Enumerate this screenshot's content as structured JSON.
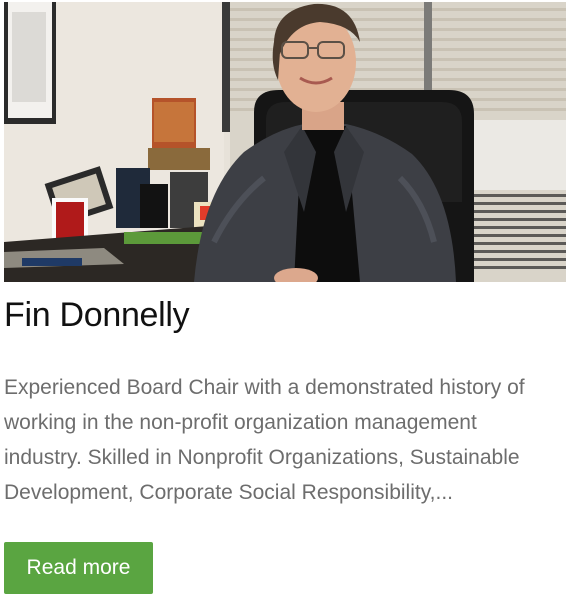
{
  "profile": {
    "name": "Fin Donnelly",
    "description": "Experienced Board Chair with a demonstrated history of working in the non-profit organization management industry. Skilled in Nonprofit Organizations, Sustainable Development, Corporate Social Responsibility,...",
    "read_more_label": "Read more"
  },
  "colors": {
    "button": "#5aa541",
    "name_text": "#111111",
    "description_text": "#6d6d6d"
  }
}
